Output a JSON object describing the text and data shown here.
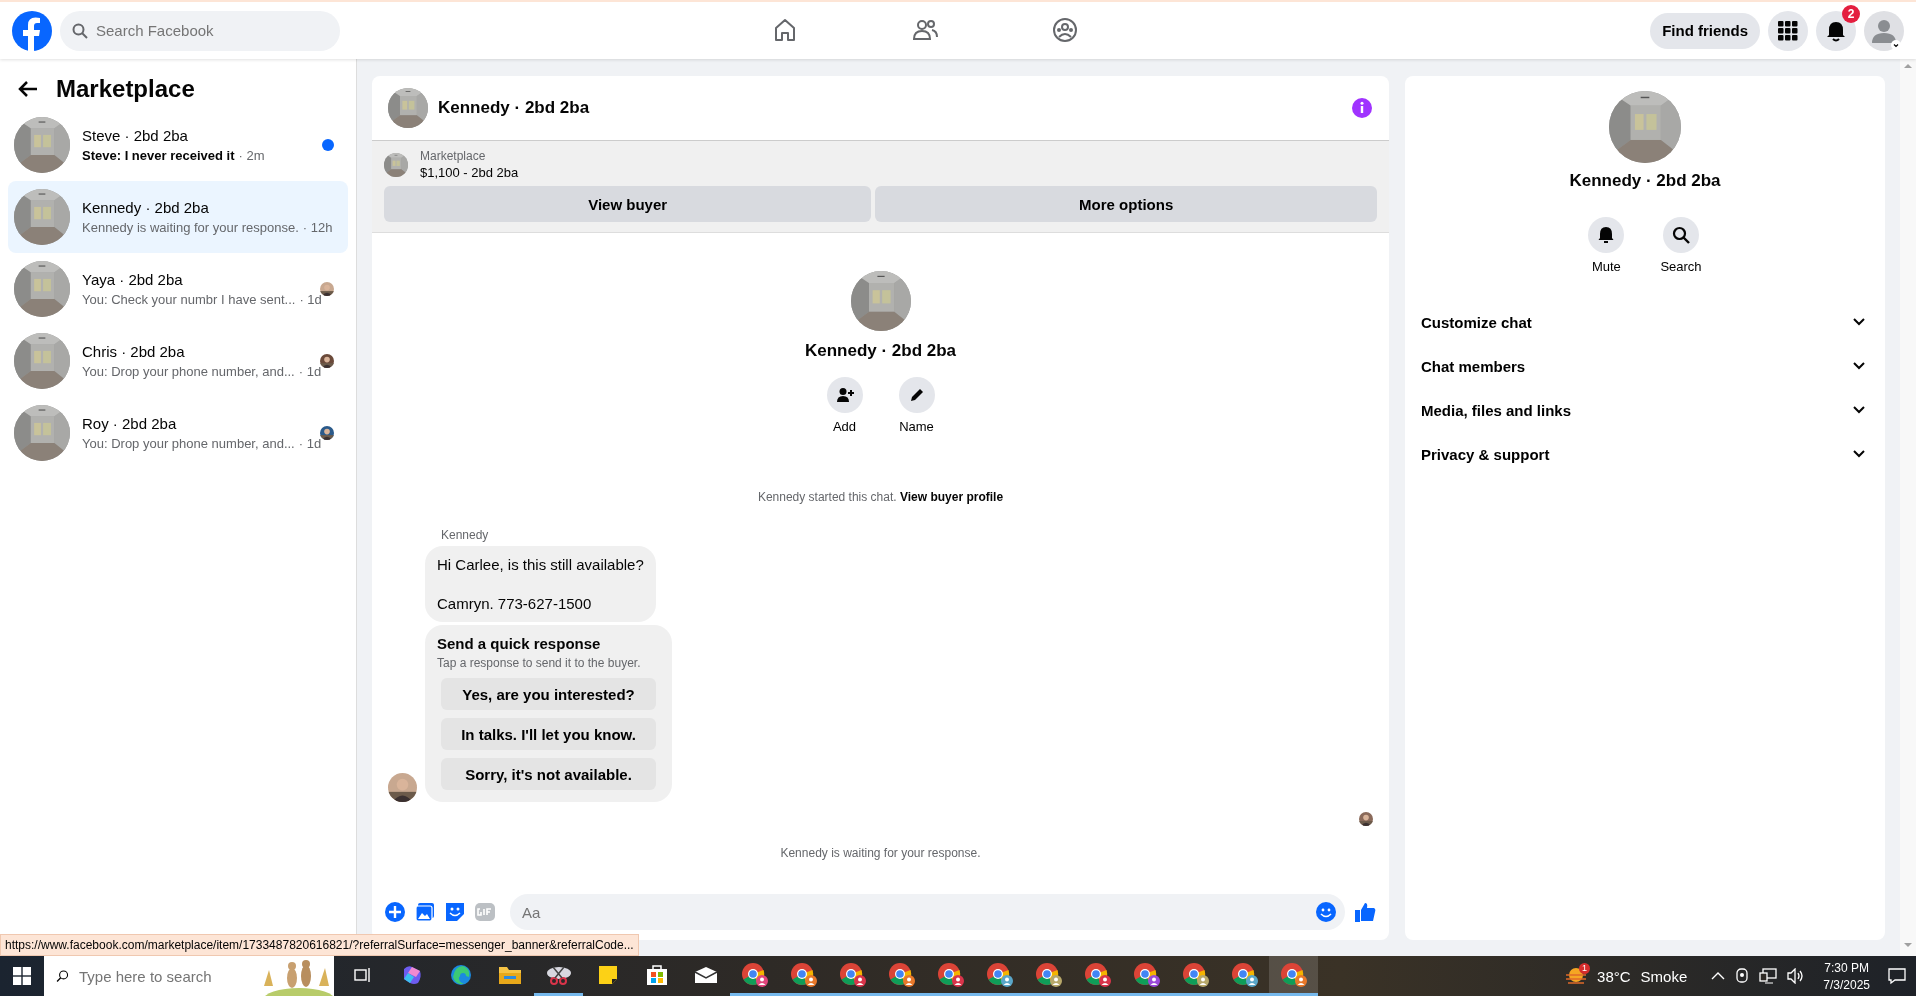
{
  "topbar": {
    "search": {
      "placeholder": "Search Facebook"
    },
    "nav": [
      {
        "kind": "home"
      },
      {
        "kind": "friends"
      },
      {
        "kind": "groups"
      }
    ],
    "find_friends": "Find friends",
    "notification_count": "2"
  },
  "sidebar": {
    "title": "Marketplace",
    "conversations": [
      {
        "name": "Steve · 2bd 2ba",
        "preview": "Steve: I never received it",
        "time": "· 2m",
        "selected": false,
        "unread": true,
        "kind": "dot"
      },
      {
        "name": "Kennedy · 2bd 2ba",
        "preview": "Kennedy is waiting for your response.",
        "time": "· 12h",
        "selected": true,
        "unread": false,
        "kind": "none"
      },
      {
        "name": "Yaya · 2bd 2ba",
        "preview": "You: Check your numbr I have sent...",
        "time": "· 1d",
        "selected": false,
        "unread": false,
        "kind": "seen"
      },
      {
        "name": "Chris · 2bd 2ba",
        "preview": "You: Drop your phone number, and...",
        "time": "· 1d",
        "selected": false,
        "unread": false,
        "kind": "seen"
      },
      {
        "name": "Roy · 2bd 2ba",
        "preview": "You: Drop your phone number, and...",
        "time": "· 1d",
        "selected": false,
        "unread": false,
        "kind": "seen"
      }
    ]
  },
  "chat": {
    "title": "Kennedy · 2bd 2ba",
    "listing": {
      "label": "Marketplace",
      "title": "$1,100 - 2bd 2ba"
    },
    "buttons": [
      "View buyer",
      "More options"
    ],
    "intro": {
      "name": "Kennedy · 2bd 2ba",
      "actions": [
        {
          "label": "Add",
          "kind": "add"
        },
        {
          "label": "Name",
          "kind": "edit"
        }
      ]
    },
    "notice": {
      "text": "Kennedy started this chat.",
      "link": "View buyer profile"
    },
    "sender": "Kennedy",
    "message_lines": [
      "Hi Carlee, is this still available?",
      "Camryn. 773-627-1500"
    ],
    "quick_response": {
      "title": "Send a quick response",
      "subtitle": "Tap a response to send it to the buyer.",
      "options": [
        "Yes, are you interested?",
        "In talks. I'll let you know.",
        "Sorry, it's not available."
      ]
    },
    "waiting": "Kennedy is waiting for your response.",
    "composer": {
      "placeholder": "Aa"
    }
  },
  "details": {
    "name": "Kennedy · 2bd 2ba",
    "actions": [
      {
        "label": "Mute",
        "kind": "bell"
      },
      {
        "label": "Search",
        "kind": "search"
      }
    ],
    "sections": [
      "Customize chat",
      "Chat members",
      "Media, files and links",
      "Privacy & support"
    ]
  },
  "status_url": "https://www.facebook.com/marketplace/item/1733487820616821/?referralSurface=messenger_banner&referralCode...",
  "taskbar": {
    "search": {
      "placeholder": "Type here to search"
    },
    "apps": [
      {
        "kind": "taskview",
        "running": false,
        "active": false
      },
      {
        "kind": "copilot",
        "running": false,
        "active": false
      },
      {
        "kind": "edge",
        "running": false,
        "active": false
      },
      {
        "kind": "folder",
        "running": false,
        "active": false
      },
      {
        "kind": "snip",
        "running": true,
        "active": false
      },
      {
        "kind": "sticky",
        "running": false,
        "active": false
      },
      {
        "kind": "store",
        "running": false,
        "active": false
      },
      {
        "kind": "mail",
        "running": false,
        "active": false
      },
      {
        "kind": "chrome",
        "color": "#e0457b",
        "running": true,
        "active": false
      },
      {
        "kind": "chrome",
        "color": "#e8782a",
        "running": true,
        "active": false
      },
      {
        "kind": "chrome",
        "color": "#d9344a",
        "running": true,
        "active": false
      },
      {
        "kind": "chrome",
        "color": "#e8782a",
        "running": true,
        "active": false
      },
      {
        "kind": "chrome",
        "color": "#d9344a",
        "running": true,
        "active": false
      },
      {
        "kind": "chrome",
        "color": "#5aa6c8",
        "running": true,
        "active": false
      },
      {
        "kind": "chrome",
        "color": "#b8a86a",
        "running": true,
        "active": false
      },
      {
        "kind": "chrome",
        "color": "#d9344a",
        "running": true,
        "active": false
      },
      {
        "kind": "chrome",
        "color": "#9a4ad9",
        "running": true,
        "active": false
      },
      {
        "kind": "chrome",
        "color": "#b8a86a",
        "running": true,
        "active": false
      },
      {
        "kind": "chrome",
        "color": "#5aa6c8",
        "running": true,
        "active": false
      },
      {
        "kind": "chrome",
        "color": "#e8782a",
        "running": true,
        "active": true
      }
    ],
    "weather": {
      "badge": "1",
      "temperature": "38°C",
      "condition": "Smoke"
    },
    "time": "7:30 PM",
    "date": "7/3/2025"
  }
}
